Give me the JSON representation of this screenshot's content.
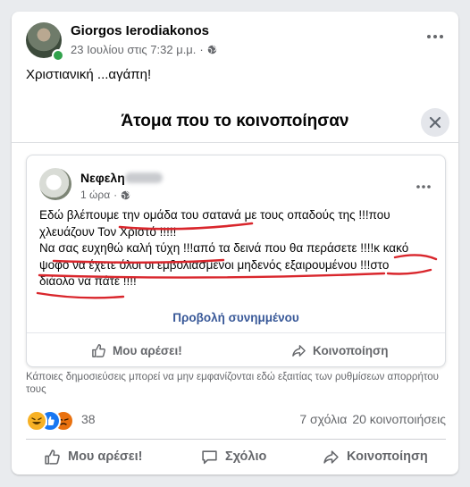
{
  "post": {
    "author": "Giorgos Ierodiakonos",
    "timestamp": "23 Ιουλίου στις 7:32 μ.μ.",
    "separator": "·",
    "caption": "Χριστιανική ...αγάπη!"
  },
  "share_dialog": {
    "title": "Άτομα που το κοινοποίησαν"
  },
  "shared_post": {
    "author": "Νεφελη",
    "time": "1 ώρα",
    "separator": "·",
    "text_lines": [
      "Εδώ βλέπουμε την ομάδα του σατανά με τους οπαδούς της !!!που",
      "χλευάζουν Τον Χριστό !!!!!",
      "Να σας ευχηθώ καλή τύχη !!!από τα δεινά που θα περάσετε !!!!κ κακό",
      "ψοφο να έχετε όλοι οι εμβολιασμενοι μηδενός εξαιρουμένου !!!στο",
      "διάολο να πάτε !!!!"
    ],
    "attachment_link": "Προβολή συνημμένου",
    "like_label": "Μου αρέσει!",
    "share_label": "Κοινοποίηση"
  },
  "notice": "Κάποιες δημοσιεύσεις μπορεί να μην εμφανίζονται εδώ εξαιτίας των ρυθμίσεων απορρήτου τους",
  "stats": {
    "reaction_count": "38",
    "comments": "7 σχόλια",
    "shares": "20 κοινοποιήσεις"
  },
  "actions": {
    "like": "Μου αρέσει!",
    "comment": "Σχόλιο",
    "share": "Κοινοποίηση"
  },
  "colors": {
    "accent_link": "#385898",
    "annotation_red": "#d9262c",
    "online": "#31a24c"
  }
}
